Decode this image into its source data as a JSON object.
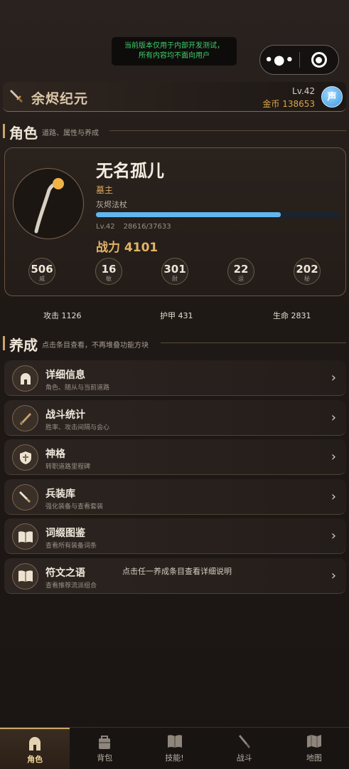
{
  "notice": {
    "line1": "当前版本仅用于内部开发测试，",
    "line2": "所有内容均不面向用户"
  },
  "capsule": {
    "more": "•●•"
  },
  "header": {
    "game_name": "余烬纪元",
    "level": "Lv.42",
    "gold": "金币 138653",
    "sound_label": "声"
  },
  "character_section": {
    "title": "角色",
    "subtitle": "道路、属性与养成"
  },
  "character": {
    "name": "无名孤儿",
    "title": "墓主",
    "weapon": "灰烬法杖",
    "xp_fraction": 0.7597,
    "level": "Lv.42",
    "xp_text": "28616/37633",
    "power": "战力 4101",
    "stats": [
      {
        "value": "506",
        "label": "威"
      },
      {
        "value": "16",
        "label": "敏"
      },
      {
        "value": "301",
        "label": "耐"
      },
      {
        "value": "22",
        "label": "运"
      },
      {
        "value": "202",
        "label": "秘"
      }
    ]
  },
  "summary": {
    "attack": "攻击 1126",
    "armor": "护甲 431",
    "life": "生命 2831"
  },
  "cultivate_section": {
    "title": "养成",
    "subtitle": "点击条目查看，不再堆叠功能方块"
  },
  "menu": [
    {
      "title": "详细信息",
      "sub": "角色、随从与当前道路",
      "icon": "helmet-icon"
    },
    {
      "title": "战斗统计",
      "sub": "胜率、攻击间隔与会心",
      "icon": "blade-icon"
    },
    {
      "title": "神格",
      "sub": "转职道路里程碑",
      "icon": "shield-icon"
    },
    {
      "title": "兵装库",
      "sub": "强化装备与查看套装",
      "icon": "dagger-icon"
    },
    {
      "title": "词缀图鉴",
      "sub": "查看所有装备词条",
      "icon": "book-icon"
    },
    {
      "title": "符文之语",
      "sub": "查看推荐流派组合",
      "icon": "book-icon"
    }
  ],
  "menu_chevron": "›",
  "tip": "点击任一养成条目查看详细说明",
  "tabs": [
    {
      "label": "角色",
      "icon": "helmet-icon",
      "active": true
    },
    {
      "label": "背包",
      "icon": "bag-icon"
    },
    {
      "label": "技能!",
      "icon": "book-icon"
    },
    {
      "label": "战斗",
      "icon": "sword-icon"
    },
    {
      "label": "地图",
      "icon": "map-icon"
    }
  ],
  "colors": {
    "accent": "#c9a46a",
    "xp": "#62b6f0",
    "gold": "#d9a54a",
    "notice": "#3ed16a"
  }
}
